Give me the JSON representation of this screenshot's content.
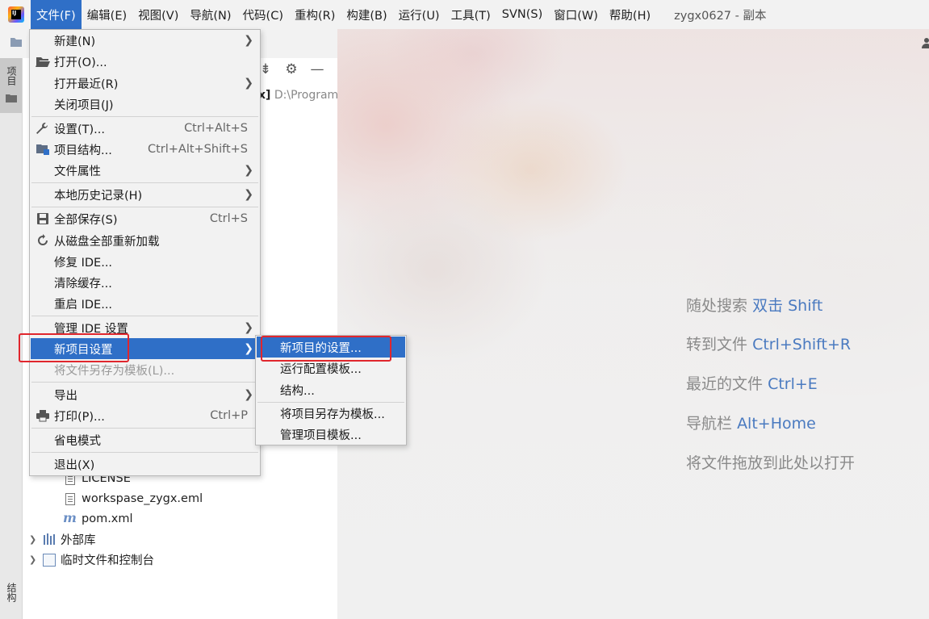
{
  "menubar": {
    "items": [
      {
        "label": "文件(F)",
        "active": true
      },
      {
        "label": "编辑(E)"
      },
      {
        "label": "视图(V)"
      },
      {
        "label": "导航(N)"
      },
      {
        "label": "代码(C)"
      },
      {
        "label": "重构(R)"
      },
      {
        "label": "构建(B)"
      },
      {
        "label": "运行(U)"
      },
      {
        "label": "工具(T)"
      },
      {
        "label": "SVN(S)"
      },
      {
        "label": "窗口(W)"
      },
      {
        "label": "帮助(H)"
      }
    ],
    "window_title": "zygx0627 - 副本"
  },
  "left_strip": {
    "project_tab": "项目",
    "structure_tab": "结构"
  },
  "project_panel": {
    "path_prefix": "x]",
    "path_text": "D:\\Program",
    "tree": [
      {
        "label": "LICENSE",
        "icon": "text-file-icon"
      },
      {
        "label": "workspase_zygx.eml",
        "icon": "text-file-icon"
      },
      {
        "label": "pom.xml",
        "icon": "maven-icon"
      },
      {
        "label": "外部库",
        "icon": "libraries-icon"
      },
      {
        "label": "临时文件和控制台",
        "icon": "scratches-icon"
      }
    ]
  },
  "file_menu": {
    "items": [
      {
        "label": "新建(N)",
        "submenu": true
      },
      {
        "label": "打开(O)...",
        "icon": "folder-open-icon"
      },
      {
        "label": "打开最近(R)",
        "submenu": true
      },
      {
        "label": "关闭项目(J)"
      },
      {
        "label": "设置(T)...",
        "shortcut": "Ctrl+Alt+S",
        "icon": "wrench-icon"
      },
      {
        "label": "项目结构...",
        "shortcut": "Ctrl+Alt+Shift+S",
        "icon": "project-structure-icon"
      },
      {
        "label": "文件属性",
        "submenu": true
      },
      {
        "label": "本地历史记录(H)",
        "submenu": true
      },
      {
        "label": "全部保存(S)",
        "shortcut": "Ctrl+S",
        "icon": "save-icon"
      },
      {
        "label": "从磁盘全部重新加载",
        "icon": "reload-icon"
      },
      {
        "label": "修复 IDE..."
      },
      {
        "label": "清除缓存..."
      },
      {
        "label": "重启 IDE..."
      },
      {
        "label": "管理 IDE 设置",
        "submenu": true
      },
      {
        "label": "新项目设置",
        "submenu": true,
        "active": true
      },
      {
        "label": "将文件另存为模板(L)...",
        "disabled": true
      },
      {
        "label": "导出",
        "submenu": true
      },
      {
        "label": "打印(P)...",
        "shortcut": "Ctrl+P",
        "icon": "print-icon"
      },
      {
        "label": "省电模式"
      },
      {
        "label": "退出(X)"
      }
    ]
  },
  "new_project_settings_submenu": {
    "items": [
      {
        "label": "新项目的设置...",
        "active": true
      },
      {
        "label": "运行配置模板..."
      },
      {
        "label": "结构..."
      },
      {
        "label": "将项目另存为模板..."
      },
      {
        "label": "管理项目模板..."
      }
    ]
  },
  "welcome_hints": [
    {
      "text": "随处搜索",
      "key": "双击 Shift"
    },
    {
      "text": "转到文件",
      "key": "Ctrl+Shift+R"
    },
    {
      "text": "最近的文件",
      "key": "Ctrl+E"
    },
    {
      "text": "导航栏",
      "key": "Alt+Home"
    },
    {
      "text": "将文件拖放到此处以打开",
      "key": ""
    }
  ],
  "colors": {
    "accent": "#2f6fc7",
    "highlight_annotation": "#e0262d",
    "menu_bg": "#f2f2f2"
  }
}
